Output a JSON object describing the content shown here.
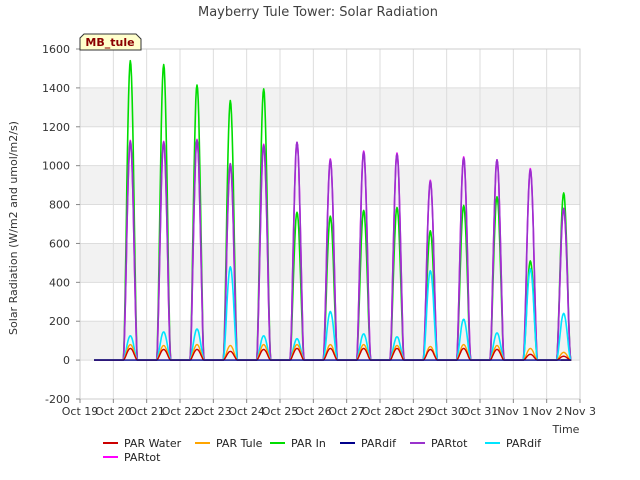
{
  "chart_data": {
    "type": "line",
    "title": "Mayberry Tule Tower: Solar Radiation",
    "xlabel": "Time",
    "ylabel": "Solar Radiation (W/m2 and umol/m2/s)",
    "badge": "MB_tule",
    "ylim": [
      -200,
      1600
    ],
    "yticks": [
      -200,
      0,
      200,
      400,
      600,
      800,
      1000,
      1200,
      1400,
      1600
    ],
    "xlim": [
      0,
      15
    ],
    "xticks": [
      "Oct 19",
      "Oct 20",
      "Oct 21",
      "Oct 22",
      "Oct 23",
      "Oct 24",
      "Oct 25",
      "Oct 26",
      "Oct 27",
      "Oct 28",
      "Oct 29",
      "Oct 30",
      "Oct 31",
      "Nov 1",
      "Nov 2",
      "Nov 3"
    ],
    "grid": true,
    "legend_position": "bottom",
    "days": [
      "Oct 20",
      "Oct 21",
      "Oct 22",
      "Oct 23",
      "Oct 24",
      "Oct 25",
      "Oct 26",
      "Oct 27",
      "Oct 28",
      "Oct 29",
      "Oct 30",
      "Oct 31",
      "Nov 1",
      "Nov 2"
    ],
    "series": [
      {
        "name": "PAR Water",
        "color": "#cc0000",
        "daily_peak": [
          60,
          55,
          55,
          45,
          55,
          60,
          60,
          60,
          60,
          55,
          60,
          55,
          30,
          20
        ]
      },
      {
        "name": "PAR Tule",
        "color": "#ffa500",
        "daily_peak": [
          80,
          75,
          80,
          75,
          80,
          80,
          80,
          80,
          75,
          70,
          80,
          75,
          60,
          40
        ]
      },
      {
        "name": "PAR In",
        "color": "#00dd00",
        "daily_peak": [
          1540,
          1520,
          1415,
          1335,
          1395,
          760,
          740,
          770,
          785,
          665,
          795,
          840,
          510,
          860
        ]
      },
      {
        "name": "PARdif",
        "color": "#00008b",
        "daily_peak": [
          0,
          0,
          0,
          0,
          0,
          0,
          0,
          0,
          0,
          0,
          0,
          0,
          0,
          0
        ]
      },
      {
        "name": "PARtot",
        "color": "#9932cc",
        "daily_peak": [
          1125,
          1120,
          1130,
          1010,
          1105,
          1120,
          1030,
          1070,
          1060,
          920,
          1040,
          1030,
          980,
          780
        ]
      },
      {
        "name": "PARdif",
        "color": "#00e5ff",
        "daily_peak": [
          125,
          145,
          160,
          480,
          125,
          110,
          250,
          135,
          120,
          460,
          210,
          140,
          470,
          240
        ]
      },
      {
        "name": "PARtot",
        "color": "#ff00ff",
        "daily_peak": [
          1130,
          1125,
          1135,
          1010,
          1110,
          1120,
          1035,
          1075,
          1065,
          925,
          1045,
          1030,
          985,
          780
        ]
      }
    ]
  }
}
